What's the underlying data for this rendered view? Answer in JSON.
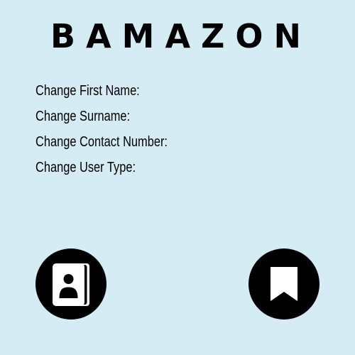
{
  "header": {
    "brand": "BAMAZON"
  },
  "form": {
    "fields": [
      {
        "label": "Change First Name:"
      },
      {
        "label": "Change Surname:"
      },
      {
        "label": "Change Contact Number:"
      },
      {
        "label": "Change User Type:"
      }
    ]
  },
  "actions": {
    "left_icon": "contact-book-icon",
    "right_icon": "bookmark-icon"
  },
  "colors": {
    "background": "#d5ecf5",
    "foreground": "#000000"
  }
}
